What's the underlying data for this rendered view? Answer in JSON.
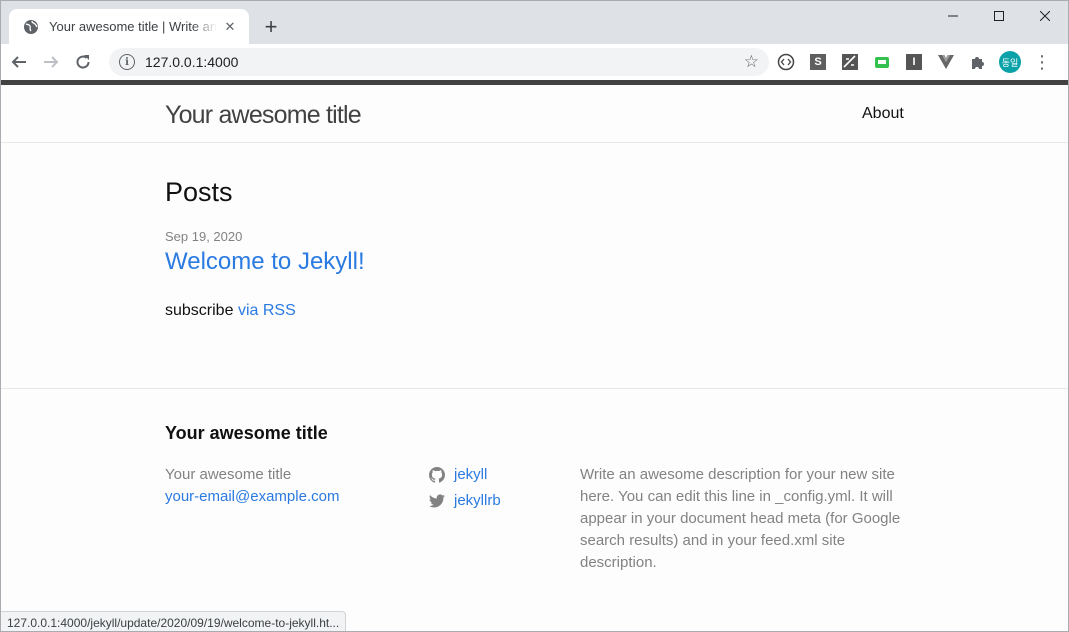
{
  "browser": {
    "tab_title": "Your awesome title | Write an awesome description",
    "tab_icon": "globe-icon",
    "new_tab_label": "+",
    "url": "127.0.0.1:4000",
    "status_url": "127.0.0.1:4000/jekyll/update/2020/09/19/welcome-to-jekyll.ht...",
    "avatar_text": "동일",
    "extensions": [
      "code-icon",
      "s-extension-icon",
      "puzzle-tools-icon",
      "green-screen-icon",
      "i-extension-icon",
      "vue-icon",
      "extensions-puzzle-icon"
    ]
  },
  "header": {
    "site_title": "Your awesome title",
    "nav": [
      {
        "label": "About"
      }
    ]
  },
  "main": {
    "heading": "Posts",
    "posts": [
      {
        "date": "Sep 19, 2020",
        "title": "Welcome to Jekyll!"
      }
    ],
    "subscribe_text": "subscribe",
    "subscribe_link": "via RSS"
  },
  "footer": {
    "heading": "Your awesome title",
    "name": "Your awesome title",
    "email": "your-email@example.com",
    "social": [
      {
        "icon": "github-icon",
        "label": "jekyll"
      },
      {
        "icon": "twitter-icon",
        "label": "jekyllrb"
      }
    ],
    "description": "Write an awesome description for your new site here. You can edit this line in _config.yml. It will appear in your document head meta (for Google search results) and in your feed.xml site description."
  },
  "colors": {
    "link": "#2a7ae2",
    "text": "#111111",
    "muted": "#828282",
    "topbar": "#424242"
  }
}
